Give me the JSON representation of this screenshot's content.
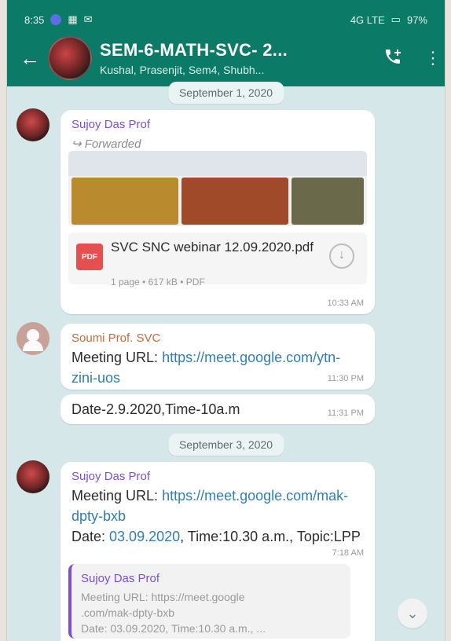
{
  "status": {
    "time": "8:35",
    "network": "4G LTE",
    "battery": "97%"
  },
  "header": {
    "back_label": "←",
    "title": "SEM-6-MATH-SVC- 2...",
    "subtitle": "Kushal, Prasenjit, Sem4, Shubh..."
  },
  "chat": {
    "chip_sep1": "September 1, 2020",
    "msg1": {
      "sender": "Sujoy Das Prof",
      "forwarded": "Forwarded",
      "pdf_name": "SVC SNC webinar 12.09.2020.pdf",
      "pdf_meta": "1 page • 617 kB • PDF",
      "time": "10:33 AM"
    },
    "msg2": {
      "sender": "Soumi Prof. SVC",
      "text_prefix": "Meeting URL: ",
      "link": "https://meet.google.com/ytn-zini-uos",
      "time": "11:30 PM"
    },
    "msg3": {
      "text": "Date-2.9.2020,Time-10a.m",
      "time": "11:31 PM"
    },
    "chip_sep2": "September 3, 2020",
    "msg4": {
      "sender": "Sujoy Das Prof",
      "text_prefix": "Meeting URL: ",
      "link": "https://meet.google.com/mak-dpty-bxb",
      "line2_prefix": "Date: ",
      "date_link": "03.09.2020",
      "line2_suffix": ", Time:10.30 a.m., Topic:LPP",
      "time": "7:18 AM",
      "quote_sender": "Sujoy Das Prof",
      "quote_line1": "Meeting URL: https://meet.google",
      "quote_line2": ".com/mak-dpty-bxb",
      "quote_line3": "Date: 03.09.2020, Time:10.30 a.m., ..."
    }
  },
  "icons": {
    "back": "arrow-left-icon",
    "call_add": "add-call-icon",
    "menu": "more-vertical-icon",
    "forward": "forward-arrow-icon",
    "download": "download-icon",
    "scroll_down": "chevrons-down-icon"
  },
  "colors": {
    "topbar": "#0b7a66",
    "chat_bg": "#d6e7ea",
    "bubble": "#ffffff",
    "sender_purple": "#7c4fd6",
    "sender_orange": "#c46a3e",
    "link": "#2f7fb0",
    "pdf": "#e45050"
  }
}
